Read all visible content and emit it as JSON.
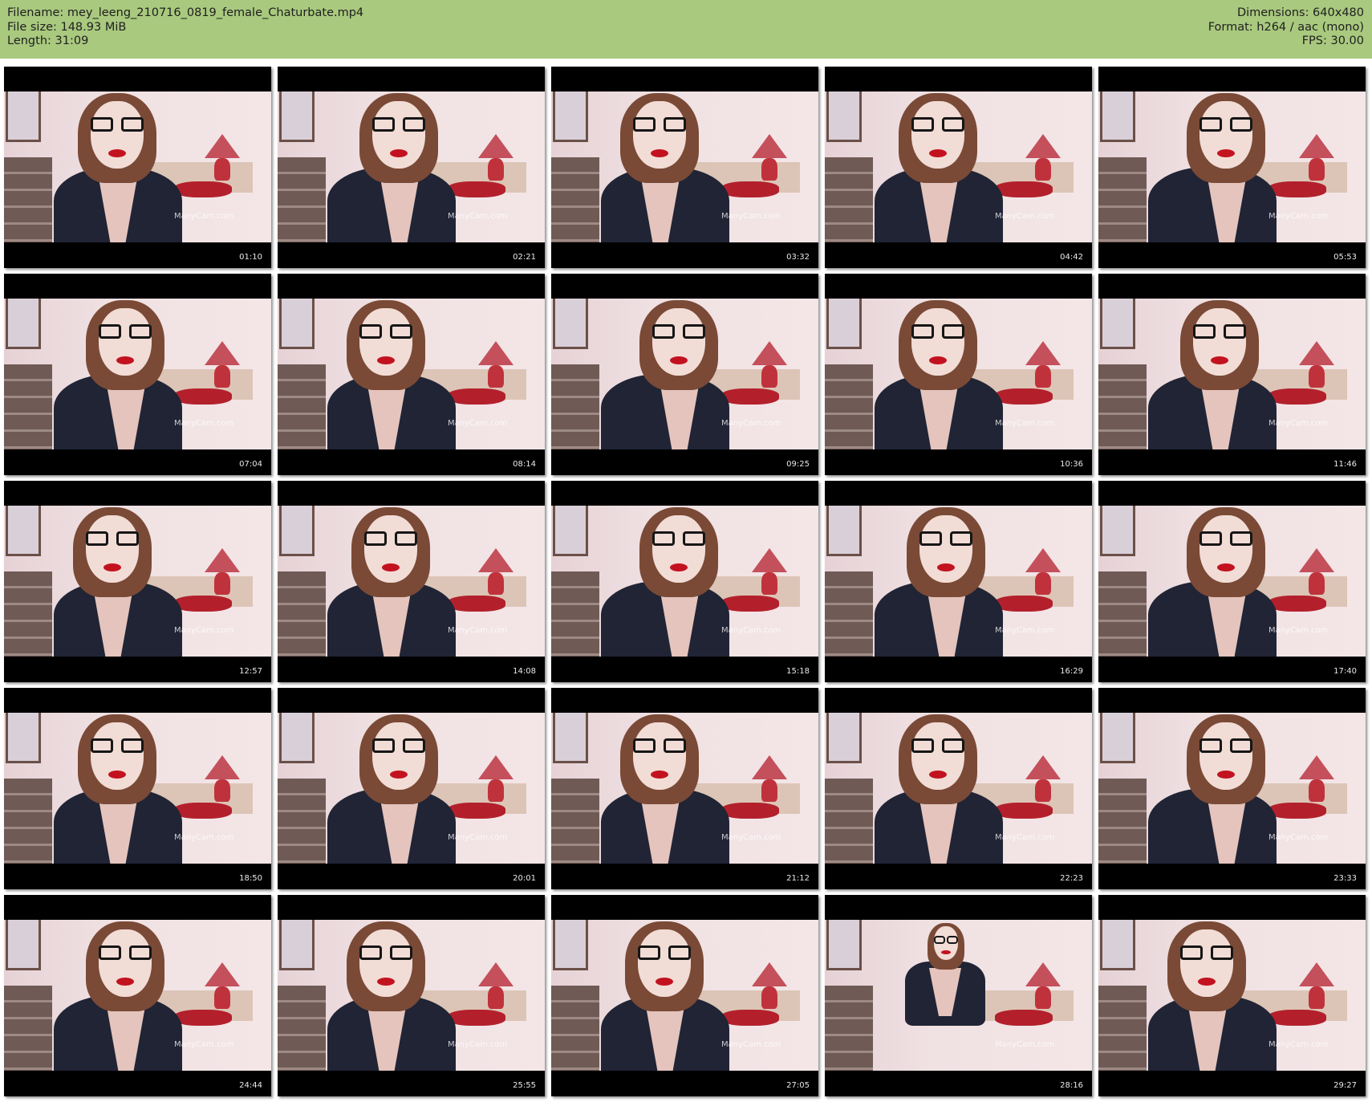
{
  "header": {
    "filename": "Filename: mey_leeng_210716_0819_female_Chaturbate.mp4",
    "filesize": "File size: 148.93 MiB",
    "length": "Length: 31:09",
    "dimensions": "Dimensions: 640x480",
    "format": "Format: h264 / aac (mono)",
    "fps": "FPS: 30.00",
    "background_color": "#a9c97e"
  },
  "thumbnails": [
    {
      "timestamp": "01:10",
      "watermark": "ManyCam.com"
    },
    {
      "timestamp": "02:21",
      "watermark": "ManyCam.com"
    },
    {
      "timestamp": "03:32",
      "watermark": "ManyCam.com"
    },
    {
      "timestamp": "04:42",
      "watermark": "ManyCam.com"
    },
    {
      "timestamp": "05:53",
      "watermark": "ManyCam.com"
    },
    {
      "timestamp": "07:04",
      "watermark": "ManyCam.com"
    },
    {
      "timestamp": "08:14",
      "watermark": "ManyCam.com"
    },
    {
      "timestamp": "09:25",
      "watermark": "ManyCam.com"
    },
    {
      "timestamp": "10:36",
      "watermark": "ManyCam.com"
    },
    {
      "timestamp": "11:46",
      "watermark": "ManyCam.com"
    },
    {
      "timestamp": "12:57",
      "watermark": "ManyCam.com"
    },
    {
      "timestamp": "14:08",
      "watermark": "ManyCam.com"
    },
    {
      "timestamp": "15:18",
      "watermark": "ManyCam.com"
    },
    {
      "timestamp": "16:29",
      "watermark": "ManyCam.com"
    },
    {
      "timestamp": "17:40",
      "watermark": "ManyCam.com"
    },
    {
      "timestamp": "18:50",
      "watermark": "ManyCam.com"
    },
    {
      "timestamp": "20:01",
      "watermark": "ManyCam.com"
    },
    {
      "timestamp": "21:12",
      "watermark": "ManyCam.com"
    },
    {
      "timestamp": "22:23",
      "watermark": "ManyCam.com"
    },
    {
      "timestamp": "23:33",
      "watermark": "ManyCam.com"
    },
    {
      "timestamp": "24:44",
      "watermark": "ManyCam.com"
    },
    {
      "timestamp": "25:55",
      "watermark": "ManyCam.com"
    },
    {
      "timestamp": "27:05",
      "watermark": "ManyCam.com"
    },
    {
      "timestamp": "28:16",
      "watermark": "ManyCam.com"
    },
    {
      "timestamp": "29:27",
      "watermark": "ManyCam.com"
    }
  ]
}
